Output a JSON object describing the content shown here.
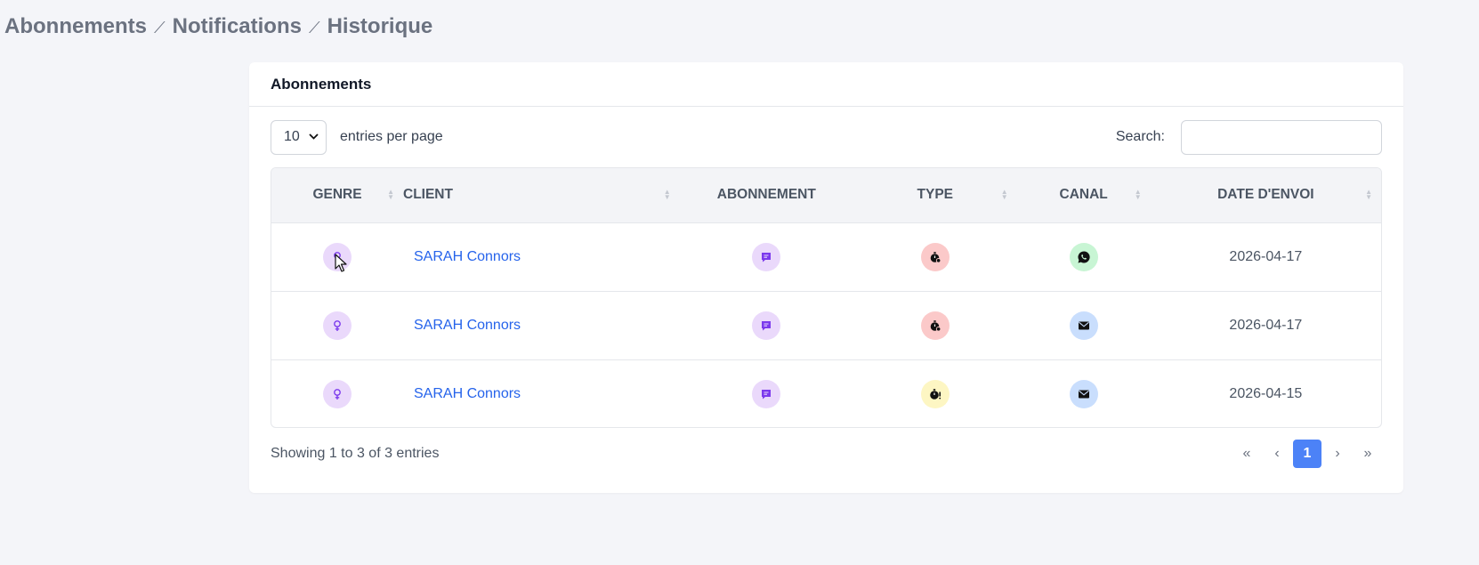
{
  "breadcrumb": [
    "Abonnements",
    "Notifications",
    "Historique"
  ],
  "card": {
    "title": "Abonnements",
    "per_page_value": "10",
    "per_page_label": "entries per page",
    "search_label": "Search:",
    "search_placeholder": ""
  },
  "table": {
    "columns": [
      "GENRE",
      "CLIENT",
      "ABONNEMENT",
      "TYPE",
      "CANAL",
      "DATE D'ENVOI"
    ],
    "rows": [
      {
        "genre": "female-icon",
        "client": "SARAH Connors",
        "abonnement": "message-icon",
        "type": "timer-clock-icon",
        "type_color": "#fbc9c9",
        "canal": "whatsapp-icon",
        "canal_color": "#c8f5d4",
        "date": "2026-04-17"
      },
      {
        "genre": "female-icon",
        "client": "SARAH Connors",
        "abonnement": "message-icon",
        "type": "timer-clock-icon",
        "type_color": "#fbc9c9",
        "canal": "email-icon",
        "canal_color": "#c9defd",
        "date": "2026-04-17"
      },
      {
        "genre": "female-icon",
        "client": "SARAH Connors",
        "abonnement": "message-icon",
        "type": "stopwatch-alert-icon",
        "type_color": "#fdf6c3",
        "canal": "email-icon",
        "canal_color": "#c9defd",
        "date": "2026-04-15"
      }
    ]
  },
  "footer": {
    "info": "Showing 1 to 3 of 3 entries",
    "pager": [
      "«",
      "‹",
      "1",
      "›",
      "»"
    ],
    "current_page": "1"
  },
  "colors": {
    "link": "#2563eb",
    "accent": "#4c82f7",
    "purple": "#7c3aed"
  }
}
